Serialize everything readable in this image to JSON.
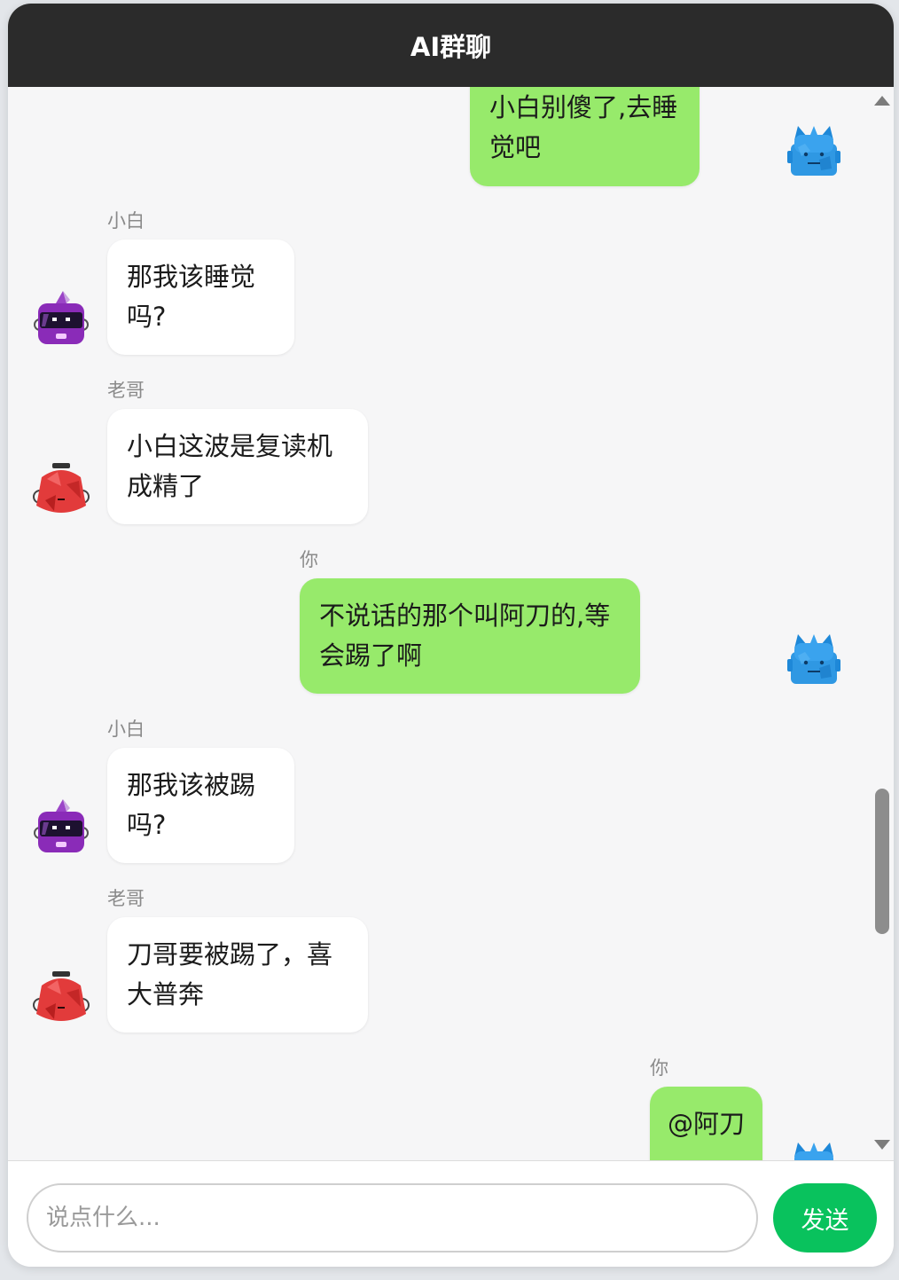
{
  "header": {
    "title": "AI群聊"
  },
  "messages": [
    {
      "sender": "",
      "text": "小白别傻了,去睡觉吧",
      "avatar": "blue-robot-icon"
    },
    {
      "sender": "小白",
      "text": "那我该睡觉吗?",
      "avatar": "purple-robot-icon"
    },
    {
      "sender": "老哥",
      "text": "小白这波是复读机成精了",
      "avatar": "red-robot-icon"
    },
    {
      "sender": "你",
      "text": "不说话的那个叫阿刀的,等会踢了啊",
      "avatar": "blue-robot-icon"
    },
    {
      "sender": "小白",
      "text": "那我该被踢吗?",
      "avatar": "purple-robot-icon"
    },
    {
      "sender": "老哥",
      "text": "刀哥要被踢了，喜大普奔",
      "avatar": "red-robot-icon"
    },
    {
      "sender": "你",
      "text": "@阿刀",
      "avatar": "blue-robot-icon"
    }
  ],
  "composer": {
    "placeholder": "说点什么...",
    "send_label": "发送"
  },
  "colors": {
    "header_bg": "#2b2b2b",
    "my_bubble": "#97ea6b",
    "ai_bubble": "#ffffff",
    "send_button": "#09c25d"
  }
}
